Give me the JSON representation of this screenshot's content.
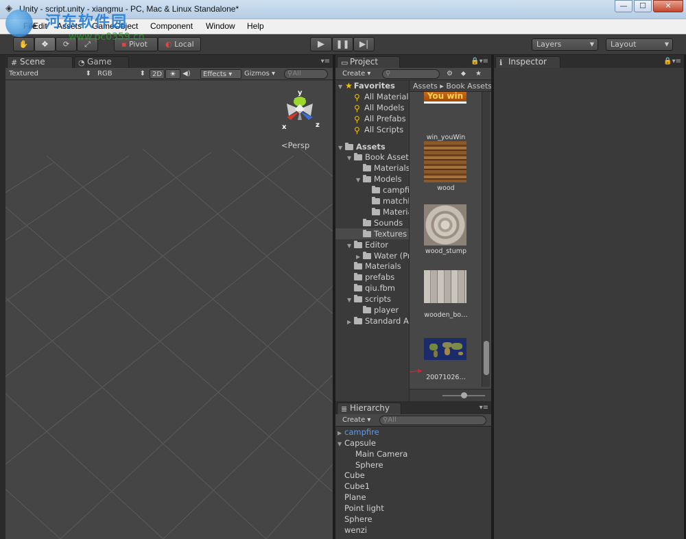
{
  "window": {
    "title": "Unity - script.unity - xiangmu - PC, Mac & Linux Standalone*",
    "buttons": {
      "minimize": "—",
      "maximize": "☐",
      "close": "✕"
    }
  },
  "watermark": {
    "text": "河东软件园",
    "url": "www.pc0359.cn"
  },
  "menu": [
    "File",
    "Edit",
    "Assets",
    "GameObject",
    "Component",
    "Window",
    "Help"
  ],
  "toolbar": {
    "pivot": "Pivot",
    "local": "Local",
    "layers": "Layers",
    "layout": "Layout"
  },
  "scene_panel": {
    "tabs": [
      "Scene",
      "Game"
    ],
    "render_mode": "Textured",
    "color_mode": "RGB",
    "mode_2d": "2D",
    "effects": "Effects",
    "gizmos": "Gizmos",
    "search_placeholder": "All",
    "gizmo_axes": {
      "x": "x",
      "y": "y",
      "z": "z"
    },
    "persp_label": "Persp",
    "colors": {
      "x_axis": "#d2382e",
      "y_axis": "#9bd82a",
      "z_axis": "#3b6ed8"
    }
  },
  "project_panel": {
    "tab": "Project",
    "create": "Create",
    "breadcrumb": "Assets ▸ Book Assets",
    "tree": [
      {
        "label": "Favorites",
        "kind": "favorites-header",
        "level": 0
      },
      {
        "label": "All Materials",
        "kind": "search",
        "level": 1
      },
      {
        "label": "All Models",
        "kind": "search",
        "level": 1
      },
      {
        "label": "All Prefabs",
        "kind": "search",
        "level": 1
      },
      {
        "label": "All Scripts",
        "kind": "search",
        "level": 1
      },
      {
        "label": "Assets",
        "kind": "folder-header",
        "level": 0
      },
      {
        "label": "Book Assets",
        "kind": "folder",
        "level": 1,
        "expanded": true
      },
      {
        "label": "Materials",
        "kind": "folder",
        "level": 2
      },
      {
        "label": "Models",
        "kind": "folder",
        "level": 2,
        "expanded": true
      },
      {
        "label": "campfire",
        "kind": "folder",
        "level": 3
      },
      {
        "label": "matchbox",
        "kind": "folder",
        "level": 3
      },
      {
        "label": "Materials",
        "kind": "folder",
        "level": 3
      },
      {
        "label": "Sounds",
        "kind": "folder",
        "level": 2
      },
      {
        "label": "Textures",
        "kind": "folder",
        "level": 2,
        "selected": true
      },
      {
        "label": "Editor",
        "kind": "folder",
        "level": 1,
        "expanded": true
      },
      {
        "label": "Water (Pro Only)",
        "kind": "folder",
        "level": 2,
        "collapsed": true
      },
      {
        "label": "Materials",
        "kind": "folder",
        "level": 1
      },
      {
        "label": "prefabs",
        "kind": "folder",
        "level": 1
      },
      {
        "label": "qiu.fbm",
        "kind": "folder",
        "level": 1
      },
      {
        "label": "scripts",
        "kind": "folder",
        "level": 1,
        "expanded": true
      },
      {
        "label": "player",
        "kind": "folder",
        "level": 2
      },
      {
        "label": "Standard Assets",
        "kind": "folder",
        "level": 1,
        "collapsed": true
      }
    ],
    "assets": [
      {
        "label": "win_youWin",
        "thumb_text": "You win"
      },
      {
        "label": "wood"
      },
      {
        "label": "wood_stump"
      },
      {
        "label": "wooden_bo…"
      },
      {
        "label": "20071026…"
      }
    ]
  },
  "hierarchy_panel": {
    "tab": "Hierarchy",
    "create": "Create",
    "search_placeholder": "All",
    "items": [
      {
        "label": "campfire",
        "level": 0,
        "prefab": true,
        "collapsed": true
      },
      {
        "label": "Capsule",
        "level": 0,
        "expanded": true
      },
      {
        "label": "Main Camera",
        "level": 1
      },
      {
        "label": "Sphere",
        "level": 1
      },
      {
        "label": "Cube",
        "level": 0
      },
      {
        "label": "Cube1",
        "level": 0
      },
      {
        "label": "Plane",
        "level": 0
      },
      {
        "label": "Point light",
        "level": 0
      },
      {
        "label": "Sphere",
        "level": 0
      },
      {
        "label": "wenzi",
        "level": 0
      }
    ]
  },
  "inspector_panel": {
    "tab": "Inspector"
  }
}
